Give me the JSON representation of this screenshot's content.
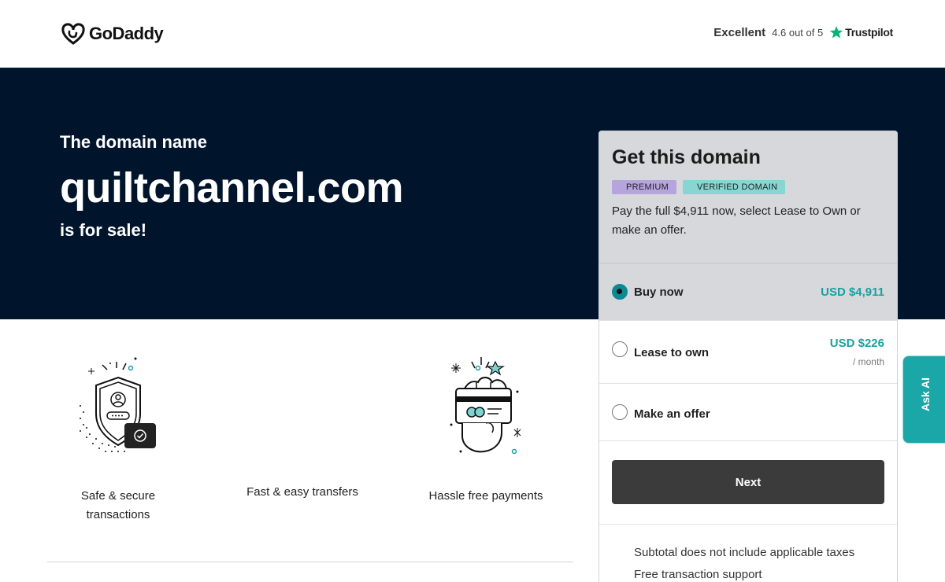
{
  "header": {
    "logo_text": "GoDaddy",
    "rating_label": "Excellent",
    "rating_score": "4.6 out of 5",
    "rating_brand": "Trustpilot"
  },
  "hero": {
    "pre": "The domain name",
    "domain": "quiltchannel.com",
    "post": "is for sale!"
  },
  "features": [
    {
      "icon": "shield-icon",
      "label_line1": "Safe & secure",
      "label_line2": "transactions"
    },
    {
      "icon": "transfer-icon",
      "label_line1": "Fast & easy transfers",
      "label_line2": ""
    },
    {
      "icon": "card-payment-icon",
      "label_line1": "Hassle free payments",
      "label_line2": ""
    }
  ],
  "card": {
    "title": "Get this domain",
    "badges": [
      "PREMIUM",
      "VERIFIED DOMAIN"
    ],
    "description": "Pay the full $4,911 now, select Lease to Own or make an offer.",
    "options": [
      {
        "label": "Buy now",
        "price": "USD $4,911",
        "per": "",
        "selected": true
      },
      {
        "label": "Lease to own",
        "price": "USD $226",
        "per": "/ month",
        "selected": false
      },
      {
        "label": "Make an offer",
        "price": "",
        "per": "",
        "selected": false
      }
    ],
    "next_label": "Next",
    "notes": [
      "Subtotal does not include applicable taxes",
      "Free transaction support"
    ]
  },
  "ask_ai": {
    "label": "Ask AI"
  },
  "colors": {
    "hero_bg": "#00142b",
    "accent_teal": "#1aa0a0",
    "button_dark": "#3b3b3b",
    "premium_badge": "#b6a4dd",
    "verified_badge": "#87d6d1",
    "trustpilot_star": "#00b67a"
  }
}
